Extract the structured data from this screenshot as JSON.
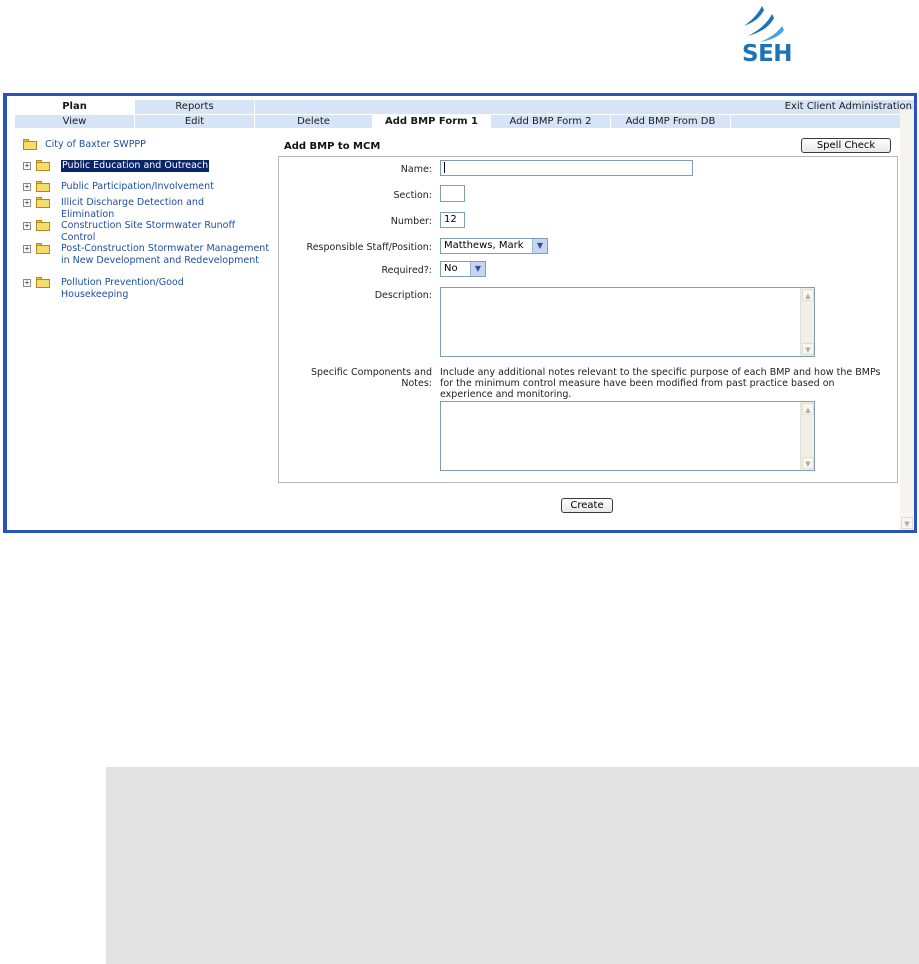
{
  "logo": {
    "text": "SEH"
  },
  "tabs": {
    "row1": [
      {
        "label": "Plan",
        "active": true
      },
      {
        "label": "Reports",
        "active": false
      },
      {
        "label": "Exit Client Administration",
        "active": false
      }
    ],
    "row2": [
      {
        "label": "View",
        "active": false
      },
      {
        "label": "Edit",
        "active": false
      },
      {
        "label": "Delete",
        "active": false
      },
      {
        "label": "Add BMP Form 1",
        "active": true
      },
      {
        "label": "Add BMP Form 2",
        "active": false
      },
      {
        "label": "Add BMP From DB",
        "active": false
      }
    ]
  },
  "tree": {
    "root": "City of Baxter SWPPP",
    "items": [
      {
        "label": "Public Education and Outreach",
        "selected": true
      },
      {
        "label": "Public Participation/Involvement",
        "selected": false
      },
      {
        "label": "Illicit Discharge Detection and Elimination",
        "selected": false
      },
      {
        "label": "Construction Site Stormwater Runoff Control",
        "selected": false
      },
      {
        "label": "Post-Construction Stormwater Management in New Development and Redevelopment",
        "selected": false
      },
      {
        "label": "Pollution Prevention/Good Housekeeping",
        "selected": false
      }
    ]
  },
  "form": {
    "title": "Add BMP to MCM",
    "spell_check": "Spell Check",
    "name_label": "Name:",
    "name_value": "",
    "section_label": "Section:",
    "section_value": "",
    "number_label": "Number:",
    "number_value": "12",
    "staff_label": "Responsible Staff/Position:",
    "staff_value": "Matthews, Mark",
    "required_label": "Required?:",
    "required_value": "No",
    "description_label": "Description:",
    "components_label": "Specific Components and Notes:",
    "components_hint": "Include any additional notes relevant to the specific purpose of each BMP and how the BMPs for the minimum control measure have been modified from past practice based on experience and monitoring.",
    "create_label": "Create"
  },
  "colors": {
    "frame_border": "#2a52be",
    "tab_bg": "#d6e4f7",
    "tree_link": "#1f4fa0",
    "selection": "#0a246a",
    "logo_blue": "#1e73b7"
  }
}
